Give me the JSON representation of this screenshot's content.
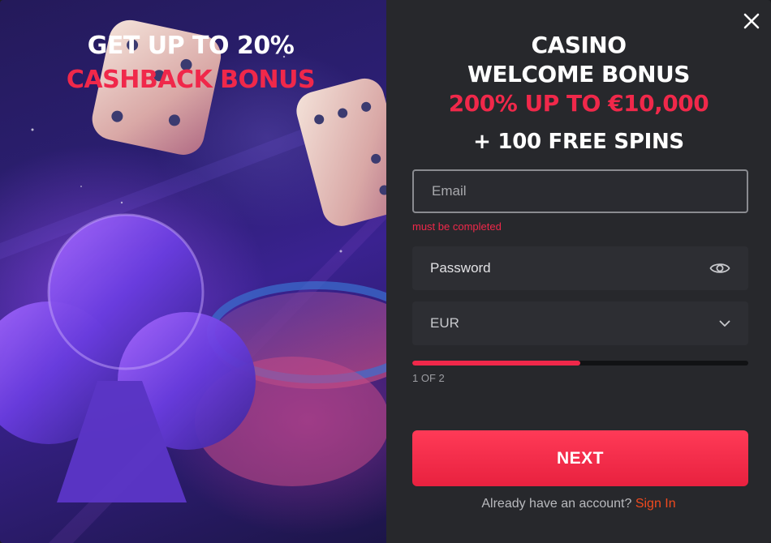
{
  "promo": {
    "line1": "GET UP TO 20%",
    "line2": "CASHBACK BONUS"
  },
  "offer": {
    "line1": "CASINO",
    "line2": "WELCOME BONUS",
    "line3": "200% UP TO €10,000",
    "line4": "+ 100 FREE SPINS"
  },
  "form": {
    "email_placeholder": "Email",
    "email_value": "",
    "email_error": "must be completed",
    "password_placeholder": "Password",
    "currency_value": "EUR"
  },
  "progress": {
    "step_label": "1 OF 2",
    "fraction": 0.5
  },
  "actions": {
    "next_label": "NEXT",
    "signin_prompt": "Already have an account?",
    "signin_link": "Sign In"
  },
  "icons": {
    "close": "close-icon",
    "eye": "eye-icon",
    "chevron": "chevron-down-icon"
  },
  "colors": {
    "accent": "#f0284a",
    "link": "#f04a1e",
    "panel": "#27282c"
  }
}
